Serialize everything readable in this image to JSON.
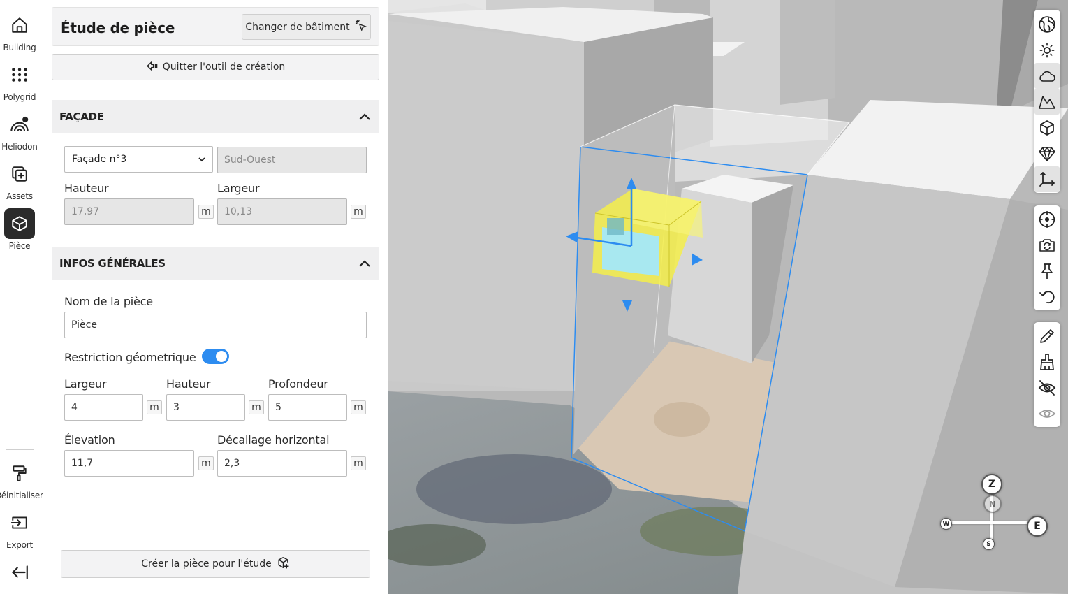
{
  "rail": {
    "items": [
      {
        "label": "Building",
        "icon": "home-icon"
      },
      {
        "label": "Polygrid",
        "icon": "grid-dots-icon"
      },
      {
        "label": "Heliodon",
        "icon": "heliodon-icon"
      },
      {
        "label": "Assets",
        "icon": "add-asset-icon"
      },
      {
        "label": "Pièce",
        "icon": "room-box-icon",
        "active": true
      }
    ],
    "bottom": [
      {
        "label": "Réinitialiser",
        "icon": "paint-roller-icon"
      },
      {
        "label": "Export",
        "icon": "export-icon"
      }
    ],
    "collapse_icon": "collapse-arrow-icon"
  },
  "panel": {
    "title": "Étude de pièce",
    "change_building_label": "Changer de bâtiment",
    "quit_label": "Quitter l'outil de création",
    "facade": {
      "section_title": "FAÇADE",
      "selected_facade": "Façade n°3",
      "orientation": "Sud-Ouest",
      "height_label": "Hauteur",
      "height_value": "17,97",
      "width_label": "Largeur",
      "width_value": "10,13",
      "unit": "m"
    },
    "infos": {
      "section_title": "INFOS GÉNÉRALES",
      "name_label": "Nom de la pièce",
      "name_value": "Pièce",
      "restriction_label": "Restriction géometrique",
      "restriction_on": true,
      "width_label": "Largeur",
      "width_value": "4",
      "height_label": "Hauteur",
      "height_value": "3",
      "depth_label": "Profondeur",
      "depth_value": "5",
      "elevation_label": "Élevation",
      "elevation_value": "11,7",
      "offset_label": "Décallage horizontal",
      "offset_value": "2,3",
      "unit": "m"
    },
    "create_label": "Créer la pièce pour l'étude"
  },
  "toolbar": {
    "group1": [
      "globe-icon",
      "sun-icon",
      "cloud-icon",
      "terrain-icon",
      "cube-icon",
      "diamond-icon",
      "axes-icon"
    ],
    "group2": [
      "target-icon",
      "camera-rotate-icon",
      "pin-icon",
      "undo-icon"
    ],
    "group3": [
      "pencil-icon",
      "brush-icon",
      "eye-off-icon",
      "eye-icon"
    ]
  },
  "compass": {
    "z": "Z",
    "e": "E",
    "w": "W",
    "s": "S",
    "n": "N"
  }
}
